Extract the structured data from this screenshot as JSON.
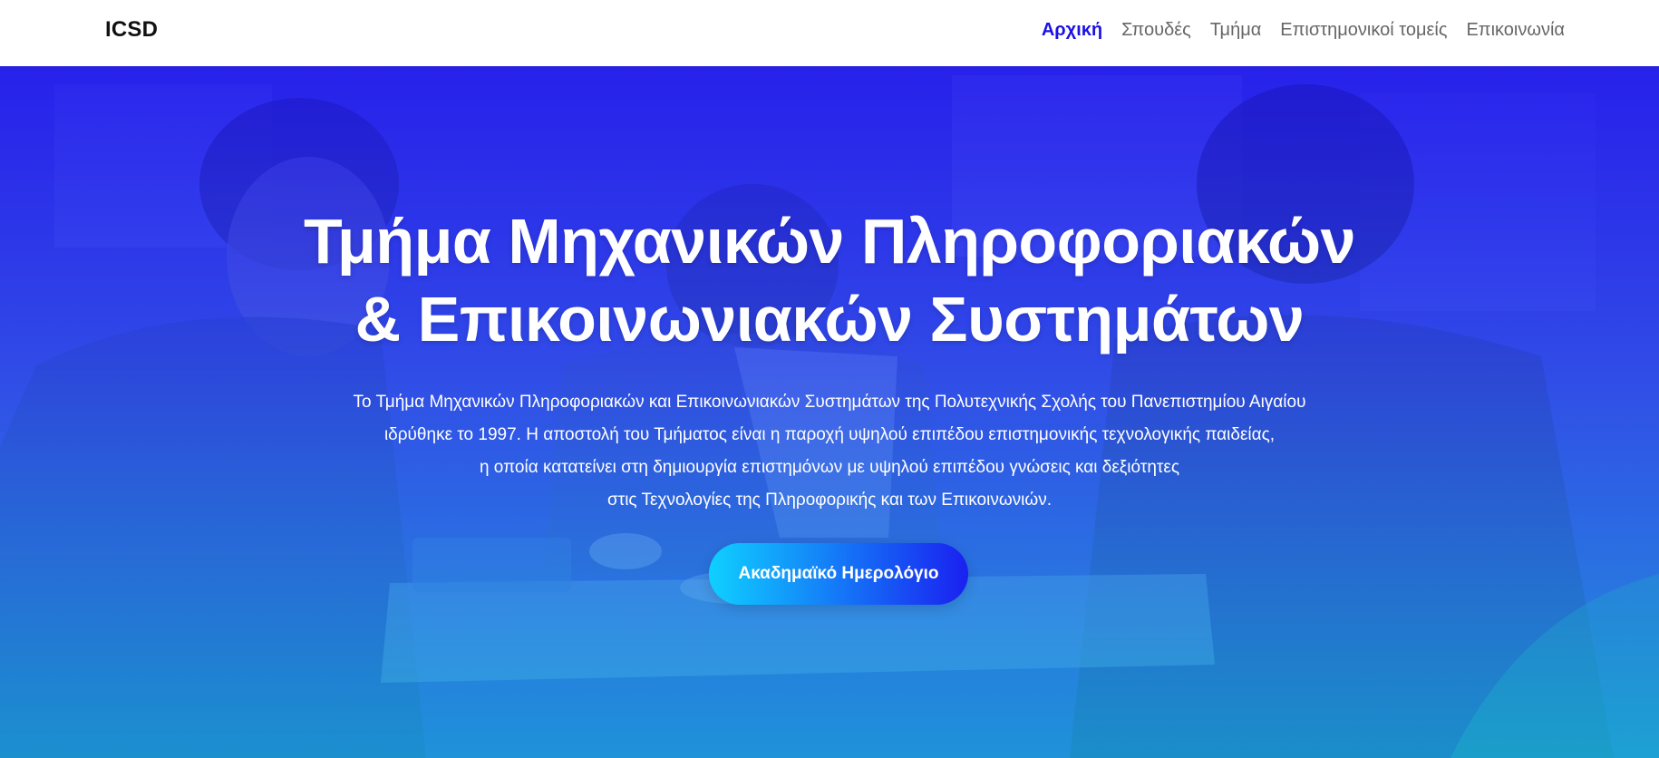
{
  "brand": "ICSD",
  "nav": {
    "items": [
      {
        "label": "Αρχική",
        "active": true
      },
      {
        "label": "Σπουδές",
        "active": false
      },
      {
        "label": "Τμήμα",
        "active": false
      },
      {
        "label": "Επιστημονικοί τομείς",
        "active": false
      },
      {
        "label": "Επικοινωνία",
        "active": false
      }
    ]
  },
  "hero": {
    "title_line1": "Τμήμα Μηχανικών Πληροφοριακών",
    "title_line2": "& Επικοινωνιακών Συστημάτων",
    "text_line1": "Το Τμήμα Μηχανικών Πληροφοριακών και Επικοινωνιακών Συστημάτων της Πολυτεχνικής Σχολής του Πανεπιστημίου Αιγαίου",
    "text_line2": "ιδρύθηκε το 1997. Η αποστολή του Τμήματος είναι η παροχή υψηλού επιπέδου επιστημονικής τεχνολογικής παιδείας,",
    "text_line3": "η οποία κατατείνει στη δημιουργία επιστημόνων με υψηλού επιπέδου γνώσεις και δεξιότητες",
    "text_line4": "στις Τεχνολογίες της Πληροφορικής και των Επικοινωνιών.",
    "cta_label": "Ακαδημαϊκό Ημερολόγιο"
  },
  "colors": {
    "accent": "#1a10e6",
    "hero_top": "#2a1bf0",
    "hero_bottom": "#12c5d6",
    "cta_start": "#0fd0ff",
    "cta_end": "#1a20f0"
  }
}
